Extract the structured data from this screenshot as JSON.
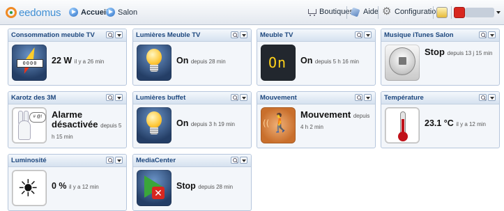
{
  "app": {
    "brand": "eedomus"
  },
  "nav": {
    "home_label": "Accueil",
    "room_label": "Salon",
    "shops_label": "Boutiques",
    "help_label": "Aide",
    "config_label": "Configuration"
  },
  "widgets": [
    {
      "title": "Consommation meuble TV",
      "value": "22 W",
      "since": "il y a 26 min",
      "meter_digits": "0000"
    },
    {
      "title": "Lumières Meuble TV",
      "value": "On",
      "since": "depuis 28 min"
    },
    {
      "title": "Meuble TV",
      "value": "On",
      "since": "depuis 5 h 16 min",
      "lcd": "On"
    },
    {
      "title": "Musique iTunes Salon",
      "value": "Stop",
      "since": "depuis 13 j 15 min"
    },
    {
      "title": "Karotz des 3M",
      "value": "Alarme désactivée",
      "since": "depuis 5 h 15 min",
      "bubble": "# @!"
    },
    {
      "title": "Lumières buffet",
      "value": "On",
      "since": "depuis 3 h 19 min"
    },
    {
      "title": "Mouvement",
      "value": "Mouvement",
      "since": "depuis 4 h 2 min"
    },
    {
      "title": "Température",
      "value": "23.1 °C",
      "since": "il y a 12 min"
    },
    {
      "title": "Luminosité",
      "value": "0 %",
      "since": "il y a 12 min"
    },
    {
      "title": "MediaCenter",
      "value": "Stop",
      "since": "depuis 28 min"
    }
  ],
  "colors": {
    "header_title": "#1c467d",
    "accent": "#3f8fd4"
  },
  "icons": {
    "energy": "energy-meter-icon",
    "light": "light-bulb-icon",
    "tv": "tv-display-icon",
    "music": "stop-disc-icon",
    "karotz": "rabbit-icon",
    "motion": "motion-walker-icon",
    "temperature": "thermometer-icon",
    "luminosity": "sun-icon",
    "media": "media-center-icon"
  }
}
